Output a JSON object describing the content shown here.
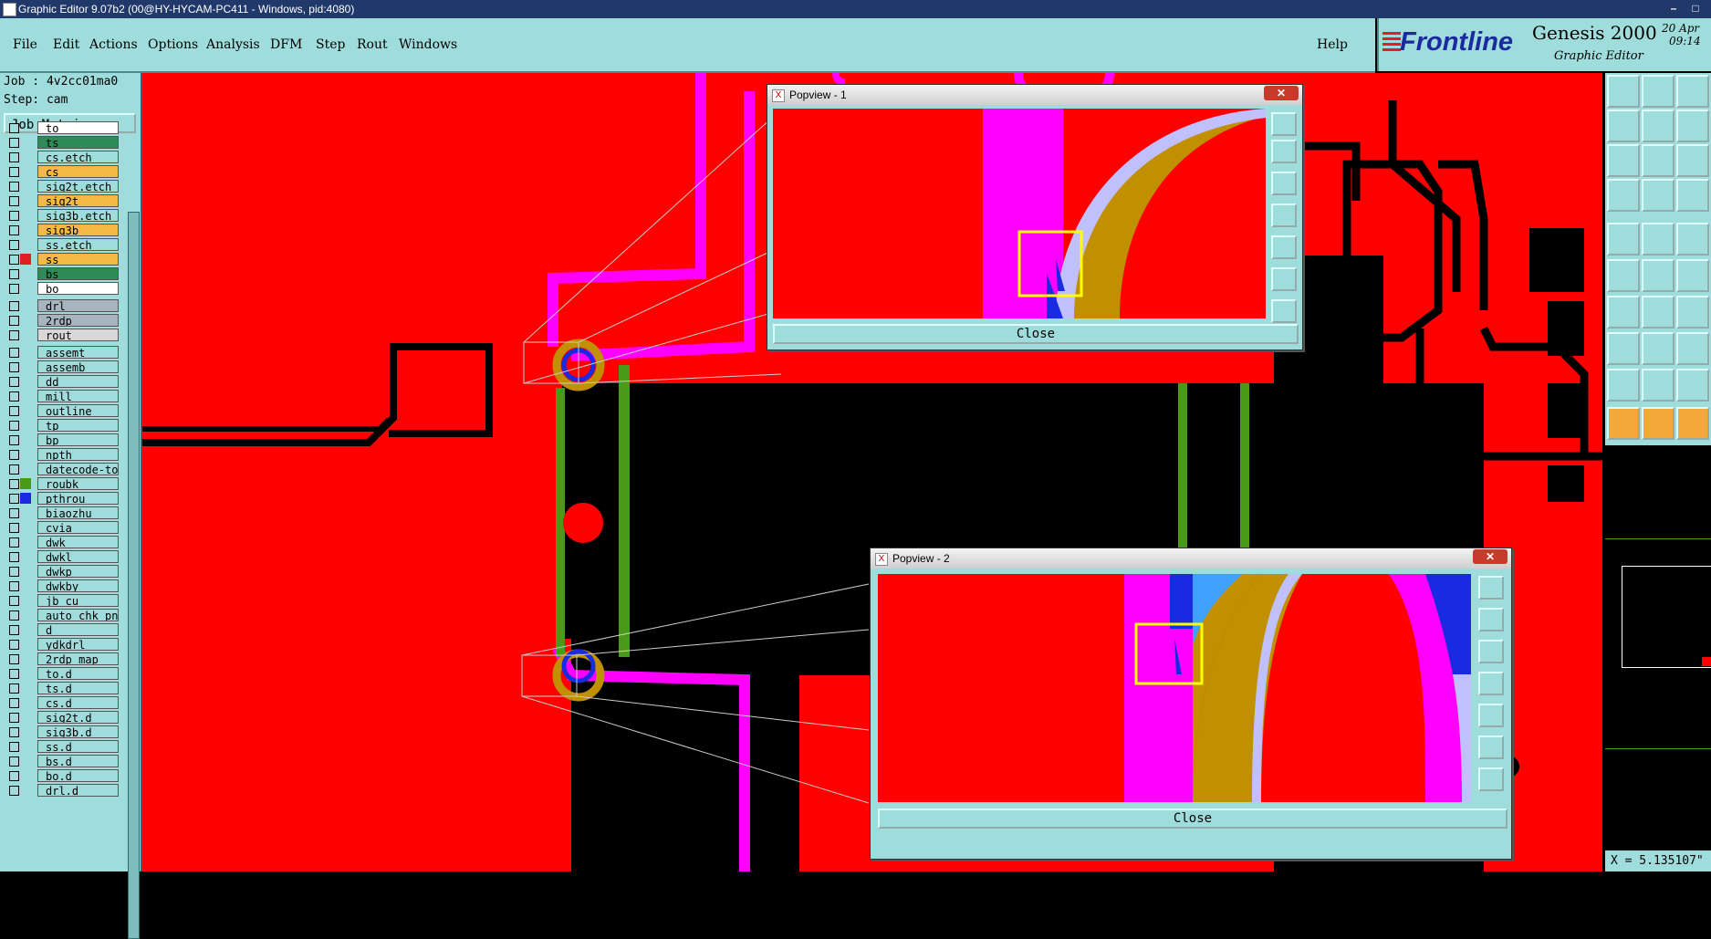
{
  "window": {
    "title": "Graphic Editor 9.07b2 (00@HY-HYCAM-PC411 - Windows, pid:4080)"
  },
  "menu": [
    {
      "label": "File",
      "name": "menu-file"
    },
    {
      "label": "Edit",
      "name": "menu-edit"
    },
    {
      "label": "Actions",
      "name": "menu-actions"
    },
    {
      "label": "Options",
      "name": "menu-options"
    },
    {
      "label": "Analysis",
      "name": "menu-analysis"
    },
    {
      "label": "DFM",
      "name": "menu-dfm"
    },
    {
      "label": "Step",
      "name": "menu-step"
    },
    {
      "label": "Rout",
      "name": "menu-rout"
    },
    {
      "label": "Windows",
      "name": "menu-windows"
    }
  ],
  "help_label": "Help",
  "brand": {
    "logo": "Frontline",
    "product": "Genesis 2000",
    "subtitle": "Graphic Editor",
    "date": "20 Apr",
    "time": "09:14"
  },
  "job": {
    "job_line": "Job : 4v2cc01ma0",
    "step_line": "Step: cam",
    "matrix_button": "Job Matrix ..."
  },
  "layers": [
    {
      "name": "to",
      "color": "#ffffff",
      "swatch": ""
    },
    {
      "name": "ts",
      "color": "#2e8b57",
      "swatch": ""
    },
    {
      "name": "cs.etch",
      "color": "#9fdcdc",
      "swatch": ""
    },
    {
      "name": "cs",
      "color": "#f4b942",
      "swatch": ""
    },
    {
      "name": "sig2t.etch",
      "color": "#9fdcdc",
      "swatch": ""
    },
    {
      "name": "sig2t",
      "color": "#f4b942",
      "swatch": ""
    },
    {
      "name": "sig3b.etch",
      "color": "#9fdcdc",
      "swatch": ""
    },
    {
      "name": "sig3b",
      "color": "#f4b942",
      "swatch": ""
    },
    {
      "name": "ss.etch",
      "color": "#9fdcdc",
      "swatch": ""
    },
    {
      "name": "ss",
      "color": "#f4b942",
      "swatch": "#e02020"
    },
    {
      "name": "bs",
      "color": "#2e8b57",
      "swatch": ""
    },
    {
      "name": "bo",
      "color": "#ffffff",
      "swatch": ""
    },
    {
      "name": "drl",
      "color": "#a8b4c0",
      "swatch": ""
    },
    {
      "name": "2rdp",
      "color": "#a8b4c0",
      "swatch": ""
    },
    {
      "name": "rout",
      "color": "#d8d8d8",
      "swatch": ""
    },
    {
      "name": "assemt",
      "color": "#9fdcdc",
      "swatch": ""
    },
    {
      "name": "assemb",
      "color": "#9fdcdc",
      "swatch": ""
    },
    {
      "name": "dd",
      "color": "#9fdcdc",
      "swatch": ""
    },
    {
      "name": "mill",
      "color": "#9fdcdc",
      "swatch": ""
    },
    {
      "name": "outline",
      "color": "#9fdcdc",
      "swatch": ""
    },
    {
      "name": "tp",
      "color": "#9fdcdc",
      "swatch": ""
    },
    {
      "name": "bp",
      "color": "#9fdcdc",
      "swatch": ""
    },
    {
      "name": "npth",
      "color": "#9fdcdc",
      "swatch": ""
    },
    {
      "name": "datecode-to",
      "color": "#9fdcdc",
      "swatch": ""
    },
    {
      "name": "roubk",
      "color": "#9fdcdc",
      "swatch": "#4a9a1a"
    },
    {
      "name": "pthrou",
      "color": "#9fdcdc",
      "swatch": "#1a2ae0"
    },
    {
      "name": "biaozhu",
      "color": "#9fdcdc",
      "swatch": ""
    },
    {
      "name": "cvia",
      "color": "#9fdcdc",
      "swatch": ""
    },
    {
      "name": "dwk",
      "color": "#9fdcdc",
      "swatch": ""
    },
    {
      "name": "dwkl",
      "color": "#9fdcdc",
      "swatch": ""
    },
    {
      "name": "dwkp",
      "color": "#9fdcdc",
      "swatch": ""
    },
    {
      "name": "dwkby",
      "color": "#9fdcdc",
      "swatch": ""
    },
    {
      "name": "jb_cu",
      "color": "#9fdcdc",
      "swatch": ""
    },
    {
      "name": "auto_chk_pni",
      "color": "#9fdcdc",
      "swatch": ""
    },
    {
      "name": "d",
      "color": "#9fdcdc",
      "swatch": ""
    },
    {
      "name": "ydkdrl",
      "color": "#9fdcdc",
      "swatch": ""
    },
    {
      "name": "2rdp_map",
      "color": "#9fdcdc",
      "swatch": ""
    },
    {
      "name": "to.d",
      "color": "#9fdcdc",
      "swatch": ""
    },
    {
      "name": "ts.d",
      "color": "#9fdcdc",
      "swatch": ""
    },
    {
      "name": "cs.d",
      "color": "#9fdcdc",
      "swatch": ""
    },
    {
      "name": "sig2t.d",
      "color": "#9fdcdc",
      "swatch": ""
    },
    {
      "name": "sig3b.d",
      "color": "#9fdcdc",
      "swatch": ""
    },
    {
      "name": "ss.d",
      "color": "#9fdcdc",
      "swatch": ""
    },
    {
      "name": "bs.d",
      "color": "#9fdcdc",
      "swatch": ""
    },
    {
      "name": "bo.d",
      "color": "#9fdcdc",
      "swatch": ""
    },
    {
      "name": "drl.d",
      "color": "#9fdcdc",
      "swatch": ""
    }
  ],
  "popviews": [
    {
      "title": "Popview - 1",
      "close_label": "Close"
    },
    {
      "title": "Popview - 2",
      "close_label": "Close"
    }
  ],
  "status": {
    "coord": "X = 5.135107\""
  },
  "colors": {
    "copper": "#ff0000",
    "mask": "#ff00ff",
    "pad": "#c09000",
    "green": "#4a9a1a",
    "blue": "#1a2ae0",
    "panel": "#9fdcdc"
  }
}
